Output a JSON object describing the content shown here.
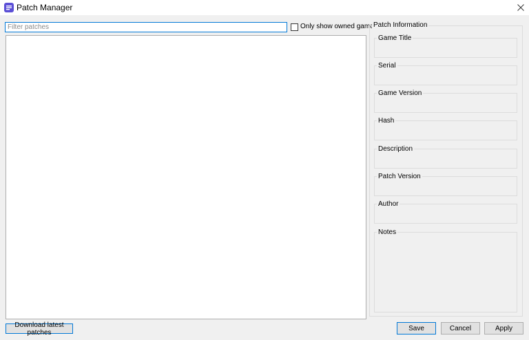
{
  "window": {
    "title": "Patch Manager",
    "accent_color": "#5b4fd6"
  },
  "filter": {
    "placeholder": "Filter patches",
    "value": ""
  },
  "owned_checkbox": {
    "label": "Only show owned games",
    "checked": false
  },
  "patch_list": {
    "items": []
  },
  "info": {
    "title": "Patch Information",
    "fields": {
      "game_title": "Game Title",
      "serial": "Serial",
      "game_version": "Game Version",
      "hash": "Hash",
      "description": "Description",
      "patch_version": "Patch Version",
      "author": "Author",
      "notes": "Notes"
    }
  },
  "buttons": {
    "download": "Download latest patches",
    "save": "Save",
    "cancel": "Cancel",
    "apply": "Apply"
  }
}
